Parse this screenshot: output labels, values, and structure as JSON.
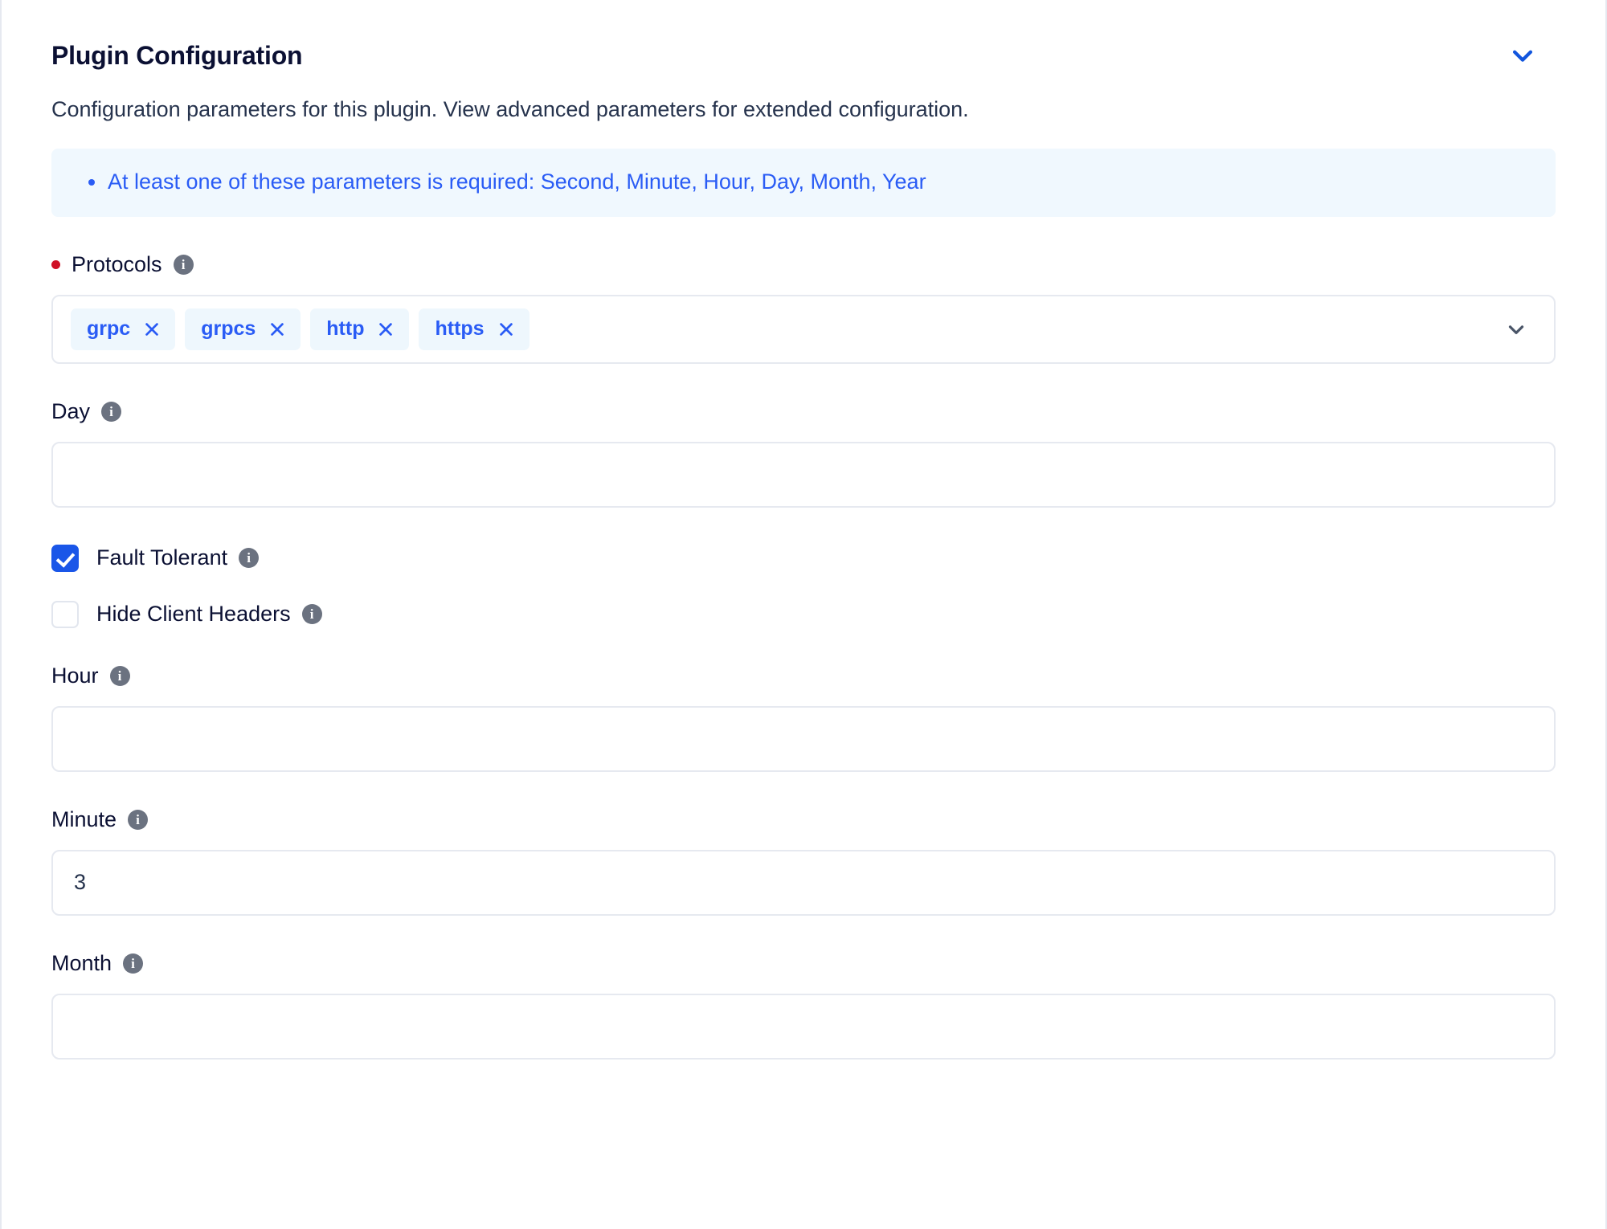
{
  "panel": {
    "title": "Plugin Configuration",
    "description": "Configuration parameters for this plugin. View advanced parameters for extended configuration.",
    "collapse_icon": "chevron-down-icon",
    "accent_color": "#2a5cf5",
    "required_color": "#cf1126",
    "title_color": "#0b1033"
  },
  "alert": {
    "type": "info",
    "background_color": "#f0f8fe",
    "text_color": "#2a5cf5",
    "items": [
      "At least one of these parameters is required: Second, Minute, Hour, Day, Month, Year"
    ]
  },
  "fields": {
    "protocols": {
      "label": "Protocols",
      "required": true,
      "info_icon": "info-icon",
      "chips": [
        {
          "label": "grpc",
          "remove_icon": "close-icon"
        },
        {
          "label": "grpcs",
          "remove_icon": "close-icon"
        },
        {
          "label": "http",
          "remove_icon": "close-icon"
        },
        {
          "label": "https",
          "remove_icon": "close-icon"
        }
      ],
      "dropdown_icon": "chevron-down-icon"
    },
    "day": {
      "label": "Day",
      "info_icon": "info-icon",
      "value": "",
      "placeholder": ""
    },
    "fault_tolerant": {
      "label": "Fault Tolerant",
      "info_icon": "info-icon",
      "checked": true
    },
    "hide_client_headers": {
      "label": "Hide Client Headers",
      "info_icon": "info-icon",
      "checked": false
    },
    "hour": {
      "label": "Hour",
      "info_icon": "info-icon",
      "value": "",
      "placeholder": ""
    },
    "minute": {
      "label": "Minute",
      "info_icon": "info-icon",
      "value": "3",
      "placeholder": ""
    },
    "month": {
      "label": "Month",
      "info_icon": "info-icon",
      "value": "",
      "placeholder": ""
    }
  },
  "glyphs": {
    "info": "i"
  }
}
